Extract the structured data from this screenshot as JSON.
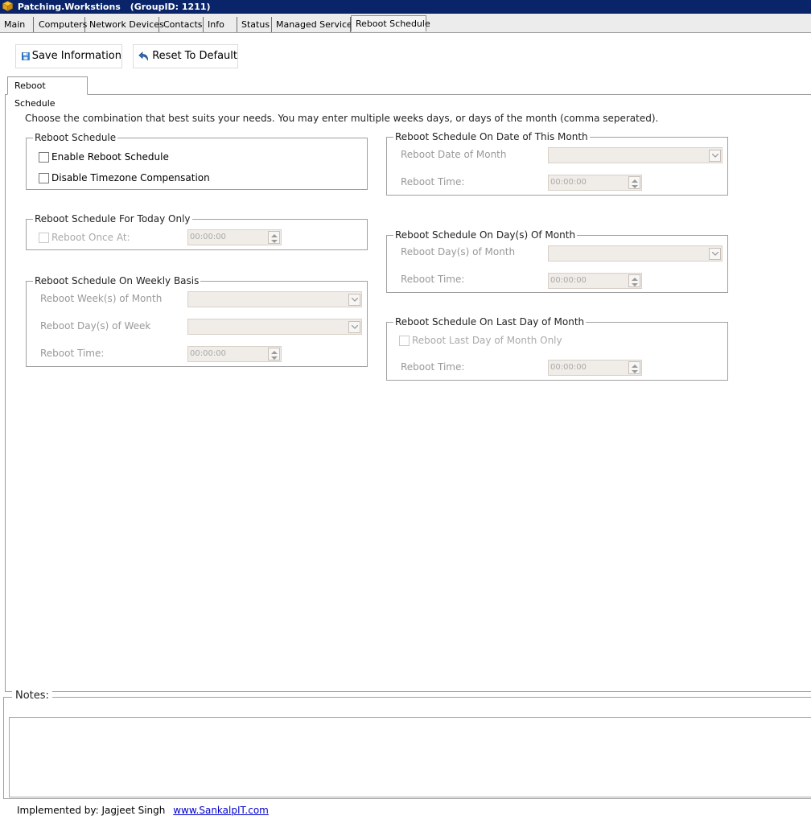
{
  "window": {
    "title": "Patching.Workstions",
    "group_label": "(GroupID: 1211)"
  },
  "tabs": [
    "Main",
    "Computers",
    "Network Devices",
    "Contacts",
    "Info",
    "Status",
    "Managed Services",
    "Reboot Schedule"
  ],
  "toolbar": {
    "save_label": "Save Information",
    "reset_label": "Reset To Default"
  },
  "subtab": {
    "label": "Reboot Schedule"
  },
  "intro_text": "Choose the combination that best suits your needs. You may enter multiple weeks days, or days of the month (comma seperated).",
  "reboot_schedule": {
    "legend": "Reboot Schedule",
    "enable_label": "Enable Reboot Schedule",
    "timezone_label": "Disable Timezone Compensation"
  },
  "today_only": {
    "legend": "Reboot Schedule For Today Only",
    "checkbox_label": "Reboot Once At:",
    "time": "00:00:00"
  },
  "weekly": {
    "legend": "Reboot Schedule On Weekly Basis",
    "weeks_label": "Reboot Week(s) of Month",
    "days_label": "Reboot Day(s) of Week",
    "time_label": "Reboot Time:",
    "time": "00:00:00"
  },
  "date_of_month": {
    "legend": "Reboot Schedule On Date of This Month",
    "date_label": "Reboot Date of Month",
    "time_label": "Reboot Time:",
    "time": "00:00:00"
  },
  "days_of_month": {
    "legend": "Reboot Schedule On Day(s) Of Month",
    "days_label": "Reboot Day(s) of Month",
    "time_label": "Reboot Time:",
    "time": "00:00:00"
  },
  "last_day": {
    "legend": "Reboot Schedule On Last Day of Month",
    "checkbox_label": "Reboot Last Day of Month Only",
    "time_label": "Reboot Time:",
    "time": "00:00:00"
  },
  "notes": {
    "legend": "Notes:",
    "value": ""
  },
  "footer": {
    "implemented_label": "Implemented by:  Jagjeet Singh",
    "link_text": "www.SankalpIT.com"
  }
}
